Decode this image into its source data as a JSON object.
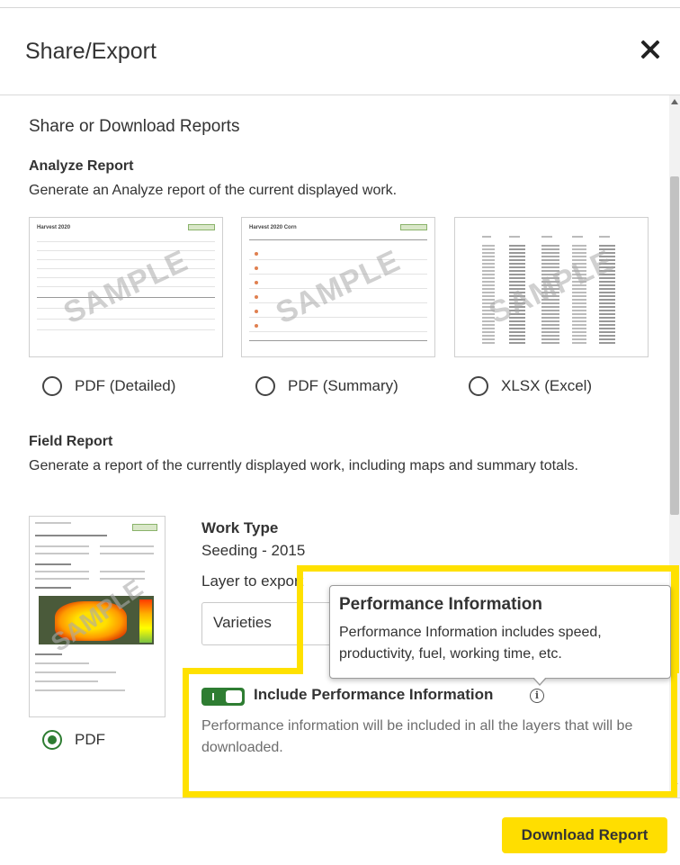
{
  "dialog": {
    "title": "Share/Export",
    "close_icon": "close-icon"
  },
  "content": {
    "section_title": "Share or Download Reports",
    "analyze": {
      "title": "Analyze Report",
      "description": "Generate an Analyze report of the current displayed work.",
      "watermark": "SAMPLE",
      "options": [
        {
          "label": "PDF (Detailed)",
          "selected": false
        },
        {
          "label": "PDF (Summary)",
          "selected": false
        },
        {
          "label": "XLSX (Excel)",
          "selected": false
        }
      ]
    },
    "field": {
      "title": "Field Report",
      "description": "Generate a report of the currently displayed work, including maps and summary totals.",
      "watermark": "SAMPLE",
      "option": {
        "label": "PDF",
        "selected": true
      },
      "work_type_label": "Work Type",
      "work_type_value": "Seeding - 2015",
      "layer_label": "Layer to export",
      "layer_value": "Varieties",
      "include_perf_label": "Include Performance Information",
      "include_perf_enabled": true,
      "perf_note": "Performance information will be included in all the layers that will be downloaded."
    },
    "tooltip": {
      "title": "Performance Information",
      "body": "Performance Information includes speed, productivity, fuel, working time, etc."
    }
  },
  "footer": {
    "download_label": "Download Report"
  },
  "colors": {
    "accent_yellow": "#ffde00",
    "highlight_yellow": "#ffe100",
    "toggle_green": "#2e7d32"
  }
}
